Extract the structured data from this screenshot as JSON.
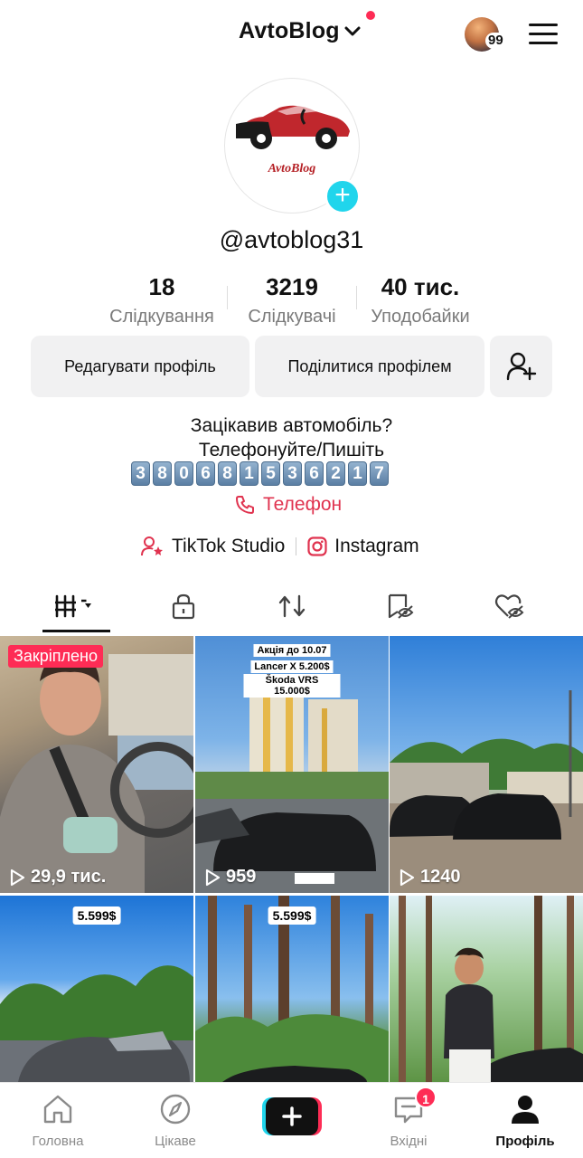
{
  "header": {
    "title": "AvtoBlog",
    "notification_count": "99"
  },
  "profile": {
    "avatar_brand": "AvtoBlog",
    "username": "@avtoblog31",
    "stats": [
      {
        "value": "18",
        "label": "Слідкування"
      },
      {
        "value": "3219",
        "label": "Слідкувачі"
      },
      {
        "value": "40 тис.",
        "label": "Уподобайки"
      }
    ],
    "buttons": {
      "edit": "Редагувати профіль",
      "share": "Поділитися профілем"
    },
    "bio_line1": "Зацікавив автомобіль?",
    "bio_line2": "Телефонуйте/Пишіть",
    "phone_digits": [
      "3",
      "8",
      "0",
      "6",
      "8",
      "1",
      "5",
      "3",
      "6",
      "2",
      "1",
      "7"
    ],
    "phone_link": "Телефон",
    "links": {
      "studio": "TikTok Studio",
      "instagram": "Instagram"
    }
  },
  "videos": [
    {
      "views": "29,9 тис.",
      "pinned": "Закріплено"
    },
    {
      "views": "959",
      "promo": [
        "Акція до 10.07",
        "Lancer X 5.200$",
        "Škoda VRS 15.000$"
      ]
    },
    {
      "views": "1240"
    },
    {
      "price": "5.599$"
    },
    {
      "price": "5.599$"
    },
    {}
  ],
  "bottom_nav": {
    "home": "Головна",
    "discover": "Цікаве",
    "inbox": "Вхідні",
    "inbox_badge": "1",
    "profile": "Профіль"
  },
  "colors": {
    "accent": "#fe2c55",
    "cyan": "#20d5ec",
    "phone_link": "#e0334f"
  }
}
